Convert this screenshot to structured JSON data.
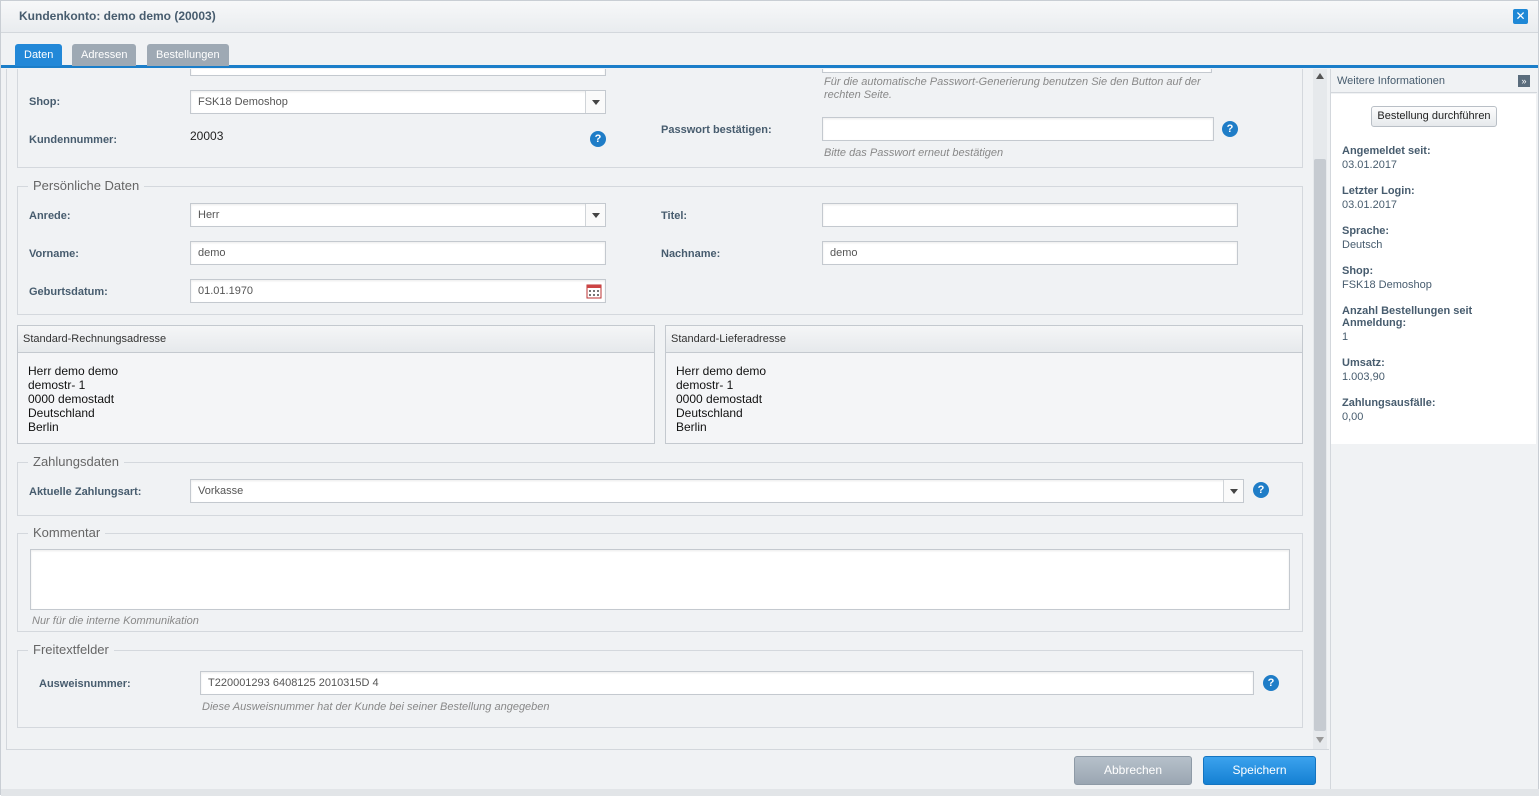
{
  "window": {
    "title": "Kundenkonto: demo demo (20003)",
    "close_icon": "close-icon",
    "accent": "#1f88d6"
  },
  "tabs": [
    {
      "label": "Daten",
      "active": true
    },
    {
      "label": "Adressen",
      "active": false
    },
    {
      "label": "Bestellungen",
      "active": false
    }
  ],
  "login": {
    "shop_label": "Shop:",
    "shop_value": "FSK18 Demoshop",
    "customer_no_label": "Kundennummer:",
    "customer_no_value": "20003",
    "password_hint": "Für die automatische Passwort-Generierung benutzen Sie den Button auf der rechten Seite.",
    "password_confirm_label": "Passwort bestätigen:",
    "password_confirm_value": "",
    "password_confirm_hint": "Bitte das Passwort erneut bestätigen"
  },
  "personal": {
    "legend": "Persönliche Daten",
    "salutation_label": "Anrede:",
    "salutation_value": "Herr",
    "title_label": "Titel:",
    "title_value": "",
    "firstname_label": "Vorname:",
    "firstname_value": "demo",
    "lastname_label": "Nachname:",
    "lastname_value": "demo",
    "birthday_label": "Geburtsdatum:",
    "birthday_value": "01.01.1970"
  },
  "billing": {
    "title": "Standard-Rechnungsadresse",
    "lines": [
      "Herr demo demo",
      "demostr- 1",
      "0000 demostadt",
      "Deutschland",
      "Berlin"
    ]
  },
  "shipping": {
    "title": "Standard-Lieferadresse",
    "lines": [
      "Herr demo demo",
      "demostr- 1",
      "0000 demostadt",
      "Deutschland",
      "Berlin"
    ]
  },
  "payment": {
    "legend": "Zahlungsdaten",
    "label": "Aktuelle Zahlungsart:",
    "value": "Vorkasse"
  },
  "comment": {
    "legend": "Kommentar",
    "value": "",
    "hint": "Nur für die interne Kommunikation"
  },
  "freetext": {
    "legend": "Freitextfelder",
    "id_label": "Ausweisnummer:",
    "id_value": "T220001293 6408125 2010315D 4",
    "id_hint": "Diese Ausweisnummer hat der Kunde bei seiner Bestellung angegeben"
  },
  "sidebar": {
    "title": "Weitere Informationen",
    "order_button": "Bestellung durchführen",
    "items": [
      {
        "label": "Angemeldet seit:",
        "value": "03.01.2017"
      },
      {
        "label": "Letzter Login:",
        "value": "03.01.2017"
      },
      {
        "label": "Sprache:",
        "value": "Deutsch"
      },
      {
        "label": "Shop:",
        "value": "FSK18 Demoshop"
      },
      {
        "label": "Anzahl Bestellungen seit Anmeldung:",
        "value": "1"
      },
      {
        "label": "Umsatz:",
        "value": "1.003,90"
      },
      {
        "label": "Zahlungsausfälle:",
        "value": "0,00"
      }
    ]
  },
  "footer": {
    "cancel_label": "Abbrechen",
    "save_label": "Speichern"
  },
  "help_icon_glyph": "?",
  "collapse_glyph": "»"
}
